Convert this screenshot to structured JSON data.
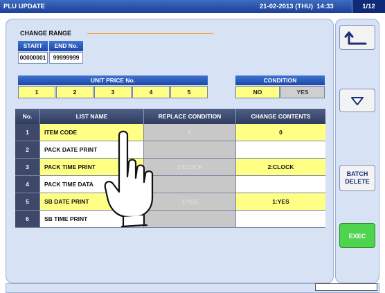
{
  "window": {
    "title": "PLU UPDATE",
    "datetime": "21-02-2013 (THU)  14:33",
    "page": "1/12"
  },
  "change_range": {
    "label": "CHANGE RANGE",
    "start_label": "START No.",
    "end_label": "END No.",
    "start_value": "00000001",
    "end_value": "99999999"
  },
  "unit_price": {
    "label": "UNIT PRICE No.",
    "options": [
      "1",
      "2",
      "3",
      "4",
      "5"
    ]
  },
  "condition": {
    "label": "CONDITION",
    "no": "NO",
    "yes": "YES"
  },
  "table": {
    "headers": {
      "no": "No.",
      "list_name": "LIST NAME",
      "replace": "REPLACE CONDITION",
      "change": "CHANGE CONTENTS"
    },
    "rows": [
      {
        "no": "1",
        "name": "ITEM CODE",
        "replace": "0",
        "change": "0",
        "highlight": true
      },
      {
        "no": "2",
        "name": "PACK DATE PRINT",
        "replace": "",
        "change": "",
        "highlight": false
      },
      {
        "no": "3",
        "name": "PACK TIME PRINT",
        "replace": "2:CLOCK",
        "change": "2:CLOCK",
        "highlight": true
      },
      {
        "no": "4",
        "name": "PACK TIME DATA",
        "replace": "",
        "change": "",
        "highlight": false
      },
      {
        "no": "5",
        "name": "SB DATE PRINT",
        "replace": "1:YES",
        "change": "1:YES",
        "highlight": true
      },
      {
        "no": "6",
        "name": "SB TIME PRINT",
        "replace": "",
        "change": "",
        "highlight": false
      }
    ]
  },
  "sidebar": {
    "back_icon": "return-arrow-icon",
    "down_icon": "down-triangle-icon",
    "batch_delete": "BATCH DELETE",
    "exec": "EXEC"
  },
  "colors": {
    "title_bar": "#2a50ab",
    "panel": "#d7e2f4",
    "highlight": "#ffff86",
    "exec": "#4fd44f",
    "header_dark": "#3e4868"
  }
}
